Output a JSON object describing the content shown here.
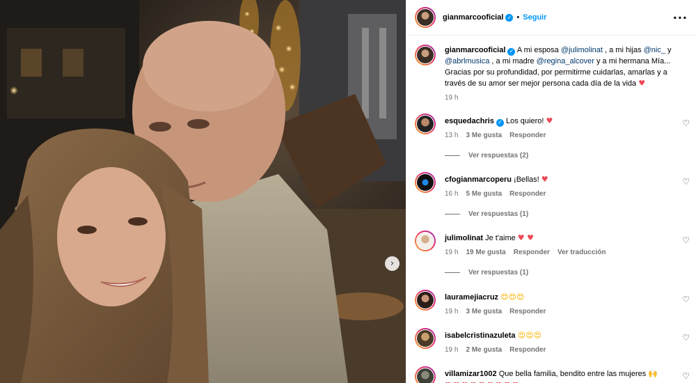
{
  "post": {
    "author": "gianmarcooficial",
    "follow_label": "Seguir",
    "more_icon": "more-horizontal-icon",
    "next_icon": "chevron-right-icon"
  },
  "caption": {
    "author": "gianmarcooficial",
    "part1": "A mi esposa ",
    "mention1": "@julimolinat",
    "part2": " , a mi hijas ",
    "mention2": "@nic_",
    "part3": " y ",
    "mention3": "@abrlmusica",
    "part4": " , a mi madre ",
    "mention4": "@regina_alcover",
    "part5": " y a mi hermana Mía... Gracias por su profundidad, por permitirme cuidarlas, amarlas y a través de su amor ser mejor persona cada día de la vida ",
    "time": "19 h"
  },
  "comments": [
    {
      "user": "esquedachris",
      "verified": true,
      "text": "Los quiero! ",
      "emoji": "♥",
      "time": "13 h",
      "likes": "3 Me gusta",
      "reply": "Responder",
      "translate": "",
      "view_replies": "Ver respuestas (2)"
    },
    {
      "user": "cfogianmarcoperu",
      "verified": false,
      "text": "¡Bellas! ",
      "emoji": "♥",
      "time": "16 h",
      "likes": "5 Me gusta",
      "reply": "Responder",
      "translate": "",
      "view_replies": "Ver respuestas (1)"
    },
    {
      "user": "julimolinat",
      "verified": false,
      "text": "Je t'aime ",
      "emoji": "♥ ♥",
      "time": "19 h",
      "likes": "19 Me gusta",
      "reply": "Responder",
      "translate": "Ver traducción",
      "view_replies": "Ver respuestas (1)"
    },
    {
      "user": "lauramejiacruz",
      "verified": false,
      "text": "",
      "emoji": "😍😍😍",
      "time": "19 h",
      "likes": "3 Me gusta",
      "reply": "Responder",
      "translate": "",
      "view_replies": ""
    },
    {
      "user": "isabelcristinazuleta",
      "verified": false,
      "text": "",
      "emoji": "😍😍😍",
      "time": "19 h",
      "likes": "2 Me gusta",
      "reply": "Responder",
      "translate": "",
      "view_replies": ""
    },
    {
      "user": "villamizar1002",
      "verified": false,
      "text": "Que bella familia, bendito entre las mujeres ",
      "emoji": "🙌",
      "time": "",
      "likes": "",
      "reply": "",
      "translate": "",
      "view_replies": ""
    }
  ],
  "colors": {
    "accent": "#0095f6",
    "heart": "#ed4956",
    "muted": "#737373"
  }
}
